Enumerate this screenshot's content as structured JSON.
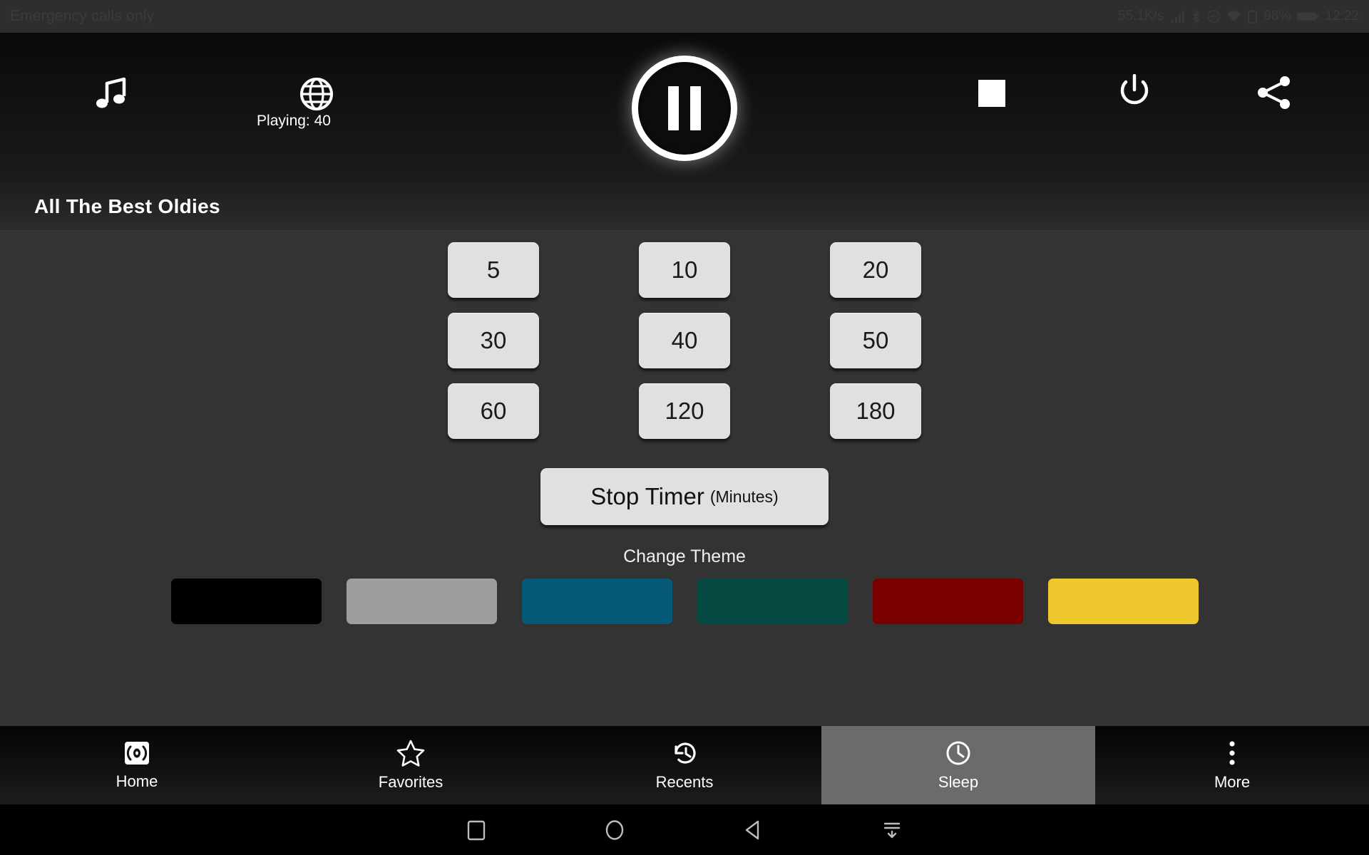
{
  "statusbar": {
    "carrier_text": "Emergency calls only",
    "network_speed": "55.1K/s",
    "battery": "98%",
    "time": "12:22",
    "icons": [
      "signal-icon",
      "bluetooth-icon",
      "wifi-icon",
      "sim-icon",
      "battery-icon"
    ]
  },
  "topbar": {
    "music_icon": "music-note-icon",
    "globe_icon": "globe-icon",
    "playing_label": "Playing: 40",
    "playpause_icon": "pause-icon",
    "stop_icon": "stop-square-icon",
    "power_icon": "power-icon",
    "share_icon": "share-icon"
  },
  "station": {
    "title": "All The Best Oldies"
  },
  "sleep": {
    "timer_buttons": [
      "5",
      "10",
      "20",
      "30",
      "40",
      "50",
      "60",
      "120",
      "180"
    ],
    "stop_timer_label": "Stop Timer",
    "stop_timer_suffix": "(Minutes)",
    "change_theme_label": "Change Theme",
    "themes": [
      {
        "name": "black",
        "color": "#000000"
      },
      {
        "name": "gray",
        "color": "#9e9e9e"
      },
      {
        "name": "blue",
        "color": "#065a78"
      },
      {
        "name": "teal",
        "color": "#044a42"
      },
      {
        "name": "red",
        "color": "#7a0000"
      },
      {
        "name": "yellow",
        "color": "#efc82e"
      }
    ]
  },
  "bottomnav": {
    "items": [
      {
        "label": "Home",
        "icon": "broadcast-icon",
        "active": false
      },
      {
        "label": "Favorites",
        "icon": "star-icon",
        "active": false
      },
      {
        "label": "Recents",
        "icon": "history-icon",
        "active": false
      },
      {
        "label": "Sleep",
        "icon": "clock-icon",
        "active": true
      },
      {
        "label": "More",
        "icon": "more-vertical-icon",
        "active": false
      }
    ],
    "active_background": "#6b6b6b"
  },
  "sysnav": {
    "buttons": [
      "recents-square-icon",
      "home-circle-icon",
      "back-triangle-icon",
      "hide-keyboard-icon"
    ]
  }
}
